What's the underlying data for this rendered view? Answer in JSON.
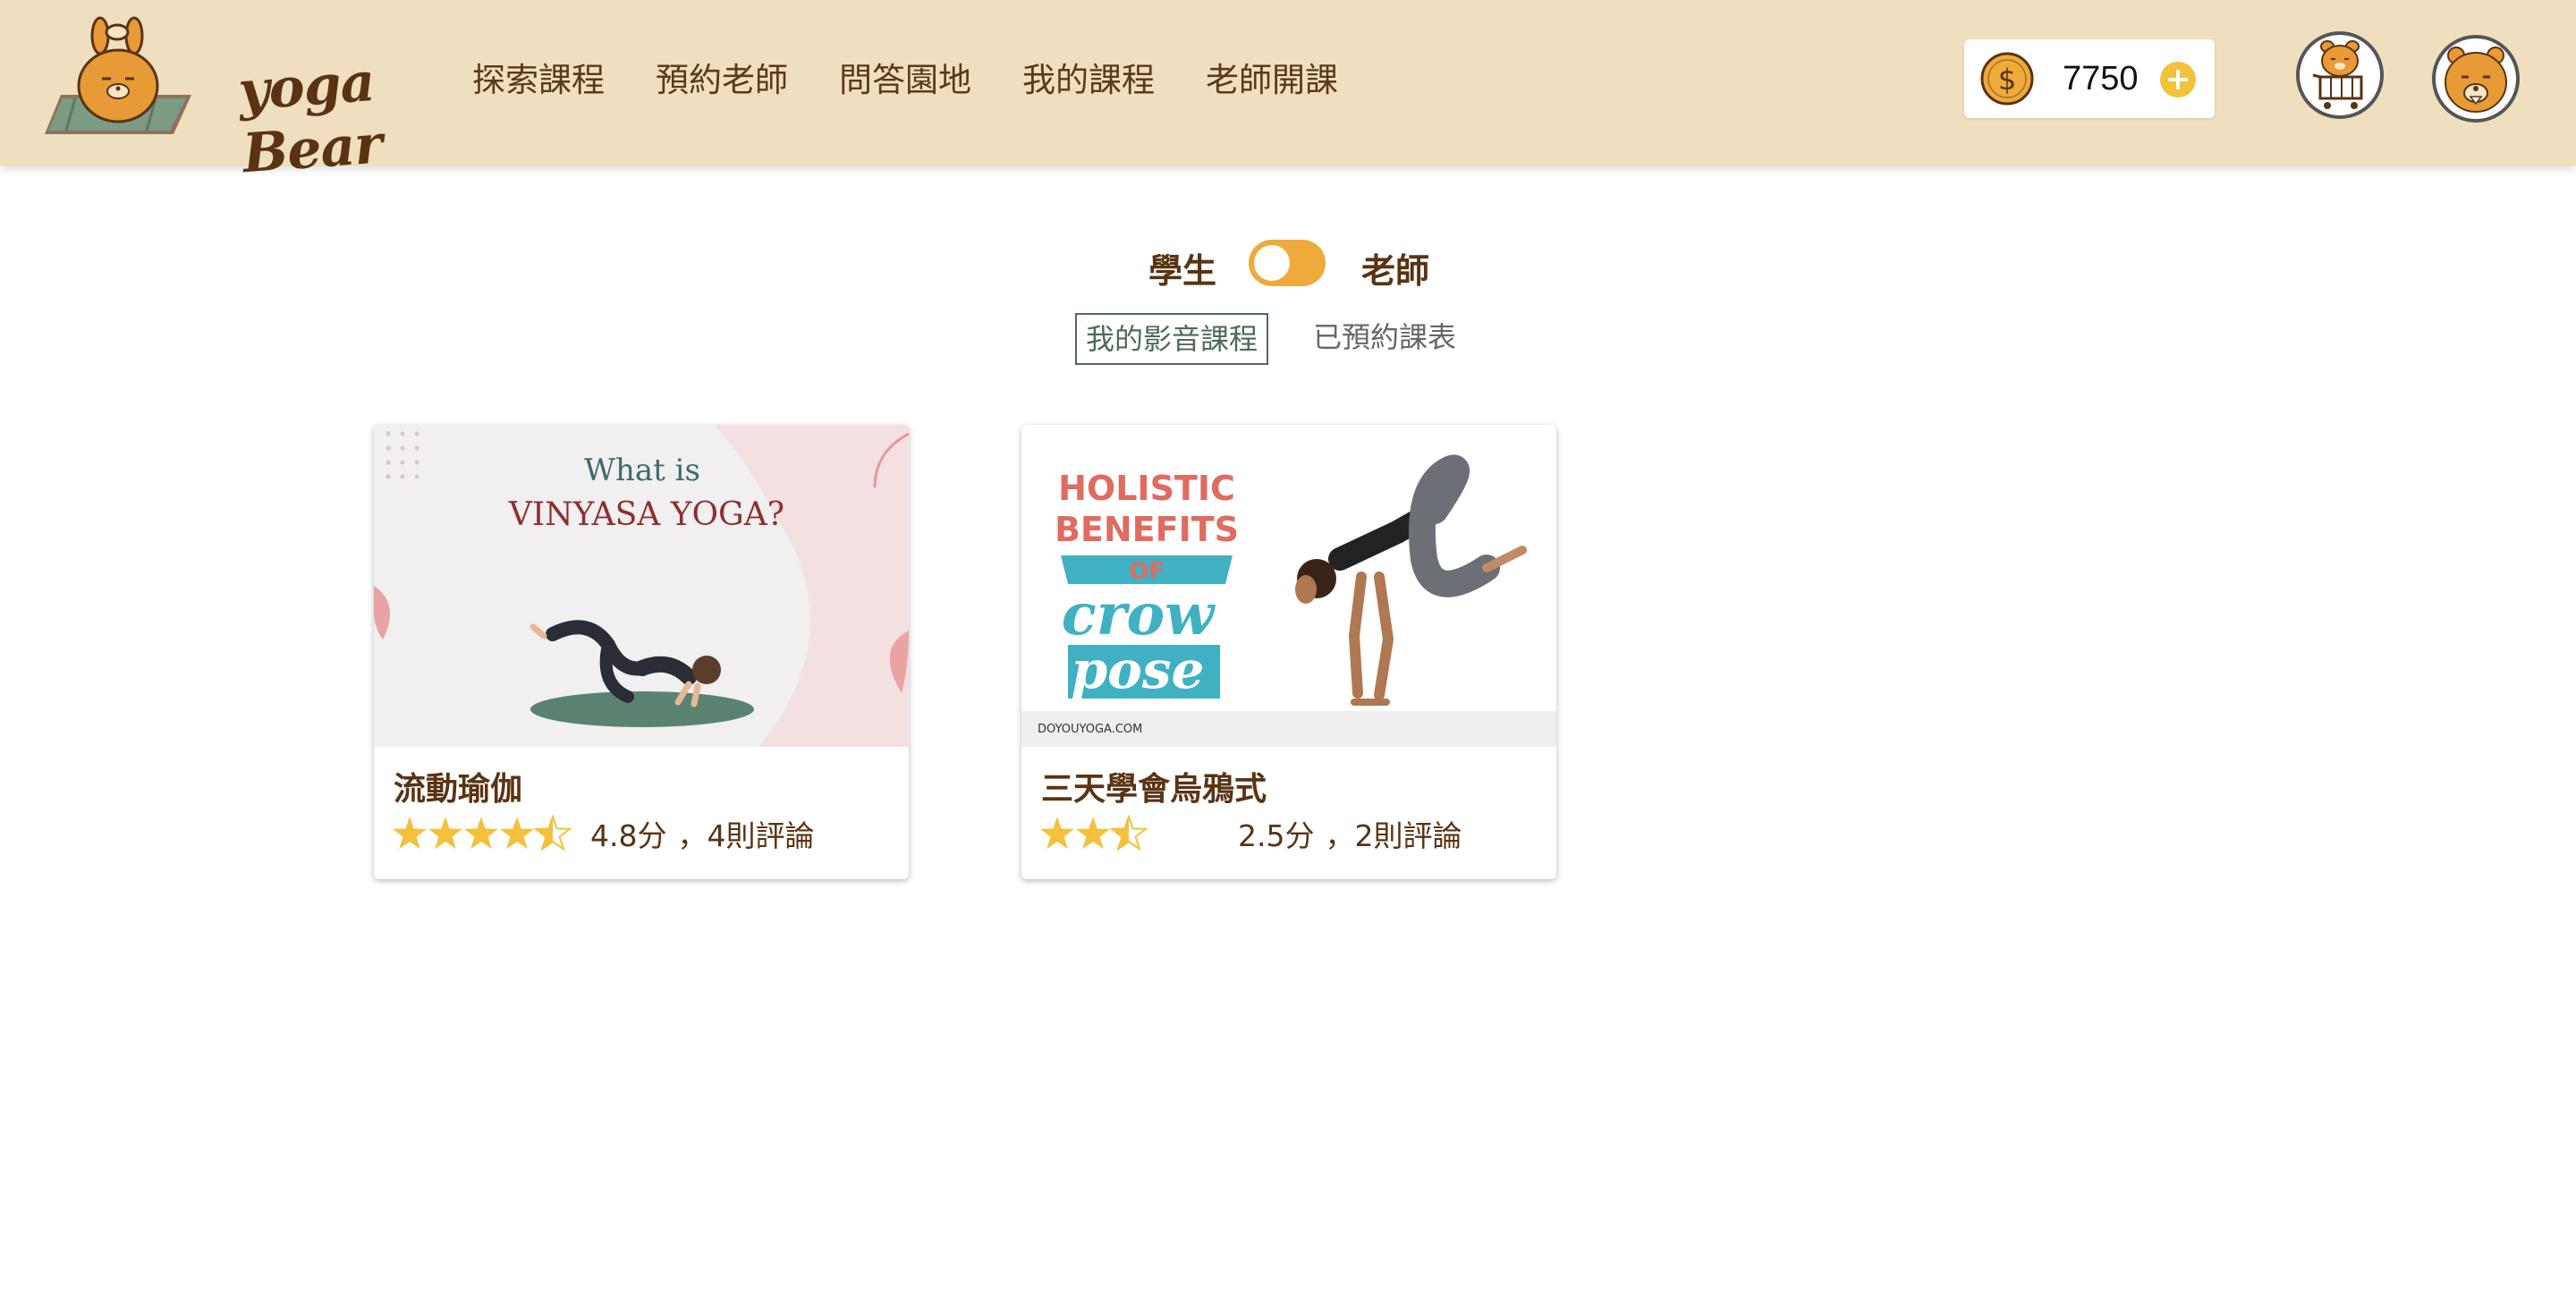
{
  "brand": {
    "logo_text": "yoga Bear"
  },
  "nav": {
    "items": [
      {
        "label": "探索課程"
      },
      {
        "label": "預約老師"
      },
      {
        "label": "問答園地"
      },
      {
        "label": "我的課程"
      },
      {
        "label": "老師開課"
      }
    ]
  },
  "points": {
    "value": "7750"
  },
  "role_toggle": {
    "student_label": "學生",
    "teacher_label": "老師",
    "state": "student"
  },
  "tabs": [
    {
      "label": "我的影音課程",
      "active": true
    },
    {
      "label": "已預約課表",
      "active": false
    }
  ],
  "courses": [
    {
      "title": "流動瑜伽",
      "rating": 4.8,
      "rating_label": "4.8分",
      "reviews_label": "，4則評論",
      "thumbnail": {
        "heading_line1": "What is",
        "heading_line2": "VINYASA YOGA?"
      }
    },
    {
      "title": "三天學會烏鴉式",
      "rating": 2.5,
      "rating_label": "2.5分",
      "reviews_label": "，2則評論",
      "thumbnail": {
        "line1": "HOLISTIC",
        "line2": "BENEFITS",
        "line3": "OF",
        "line4": "crow",
        "line5": "pose",
        "credit": "DOYOUYOGA.COM"
      }
    }
  ],
  "colors": {
    "header_bg": "#efdfbe",
    "brown_text": "#5a3313",
    "accent_orange": "#eeaa3a",
    "star_gold": "#f3c13b",
    "tab_green": "#4e6b54"
  },
  "icons": {
    "coin": "dollar-coin-icon",
    "plus": "plus-circle-icon",
    "cart": "bear-cart-avatar",
    "user": "bear-avatar"
  }
}
